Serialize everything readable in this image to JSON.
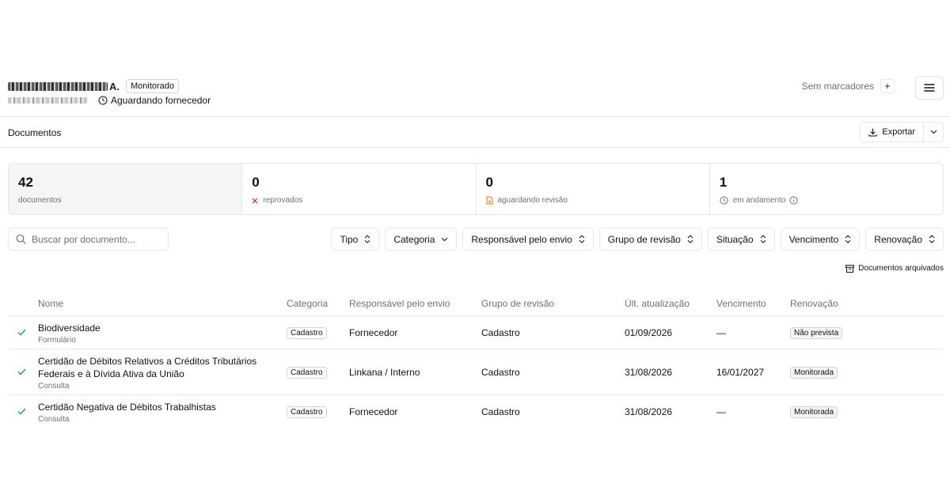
{
  "header": {
    "company_suffix": "A.",
    "monitor_badge": "Monitorado",
    "status": "Aguardando fornecedor",
    "tags_label": "Sem marcadores",
    "add_tag": "+"
  },
  "section": {
    "title": "Documentos",
    "export_label": "Exportar"
  },
  "stats": [
    {
      "value": "42",
      "label": "documentos"
    },
    {
      "value": "0",
      "label": "reprovados"
    },
    {
      "value": "0",
      "label": "aguardando revisão"
    },
    {
      "value": "1",
      "label": "em andamento"
    }
  ],
  "search": {
    "placeholder": "Buscar por documento..."
  },
  "filters": [
    "Tipo",
    "Categoria",
    "Responsável pelo envio",
    "Grupo de revisão",
    "Situação",
    "Vencimento",
    "Renovação"
  ],
  "archived_label": "Documentos arquivados",
  "table": {
    "columns": [
      "Nome",
      "Categoria",
      "Responsável pelo envio",
      "Grupo de revisão",
      "Últ. atualização",
      "Vencimento",
      "Renovação"
    ],
    "rows": [
      {
        "name_line1": "Biodiversidade",
        "name_line2": "",
        "type": "Formulário",
        "category": "Cadastro",
        "responsible": "Fornecedor",
        "review_group": "Cadastro",
        "updated": "01/09/2026",
        "due": "—",
        "renewal": "Não prevista"
      },
      {
        "name_line1": "Certidão de Débitos Relativos a Créditos Tributários",
        "name_line2": "Federais e à Dívida Ativa da União",
        "type": "Consulta",
        "category": "Cadastro",
        "responsible": "Linkana / Interno",
        "review_group": "Cadastro",
        "updated": "31/08/2026",
        "due": "16/01/2027",
        "renewal": "Monitorada"
      },
      {
        "name_line1": "Certidão Negativa de Débitos Trabalhistas",
        "name_line2": "",
        "type": "Consulta",
        "category": "Cadastro",
        "responsible": "Fornecedor",
        "review_group": "Cadastro",
        "updated": "31/08/2026",
        "due": "—",
        "renewal": "Monitorada"
      }
    ]
  },
  "colors": {
    "check_green": "#16a34a",
    "reject_red": "#dc2626",
    "pending_amber": "#d97706",
    "border": "#e5e7eb",
    "muted_text": "#6b7280"
  }
}
